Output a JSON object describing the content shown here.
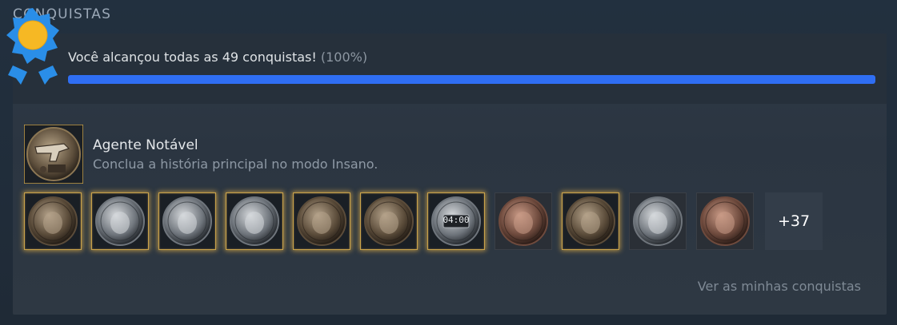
{
  "section": {
    "title": "CONQUISTAS"
  },
  "progress": {
    "text": "Você alcançou todas as 49 conquistas!",
    "percent_text": "(100%)",
    "percent": 100,
    "bar_color": "#2f6ef3"
  },
  "featured": {
    "name": "Agente Notável",
    "description": "Conclua a história principal no modo Insano.",
    "icon": "revolver-icon"
  },
  "achievements": [
    {
      "icon": "figures-icon",
      "tier": "gold"
    },
    {
      "icon": "thumbs-up-icon",
      "tier": "gold"
    },
    {
      "icon": "monitor-icon",
      "tier": "gold"
    },
    {
      "icon": "woman-book-icon",
      "tier": "gold"
    },
    {
      "icon": "plant-icon",
      "tier": "gold"
    },
    {
      "icon": "woman-portrait-icon",
      "tier": "gold"
    },
    {
      "icon": "clock-icon",
      "tier": "gold",
      "label": "04:00"
    },
    {
      "icon": "creature-icon",
      "tier": "plain"
    },
    {
      "icon": "documents-icon",
      "tier": "gold"
    },
    {
      "icon": "box-icon",
      "tier": "plain"
    },
    {
      "icon": "objects-icon",
      "tier": "plain"
    }
  ],
  "more_count": "+37",
  "view_link": "Ver as minhas conquistas",
  "colors": {
    "gold_glow": "#e1af46",
    "medal_blue": "#2a8ee8",
    "medal_gold": "#f6b824"
  }
}
